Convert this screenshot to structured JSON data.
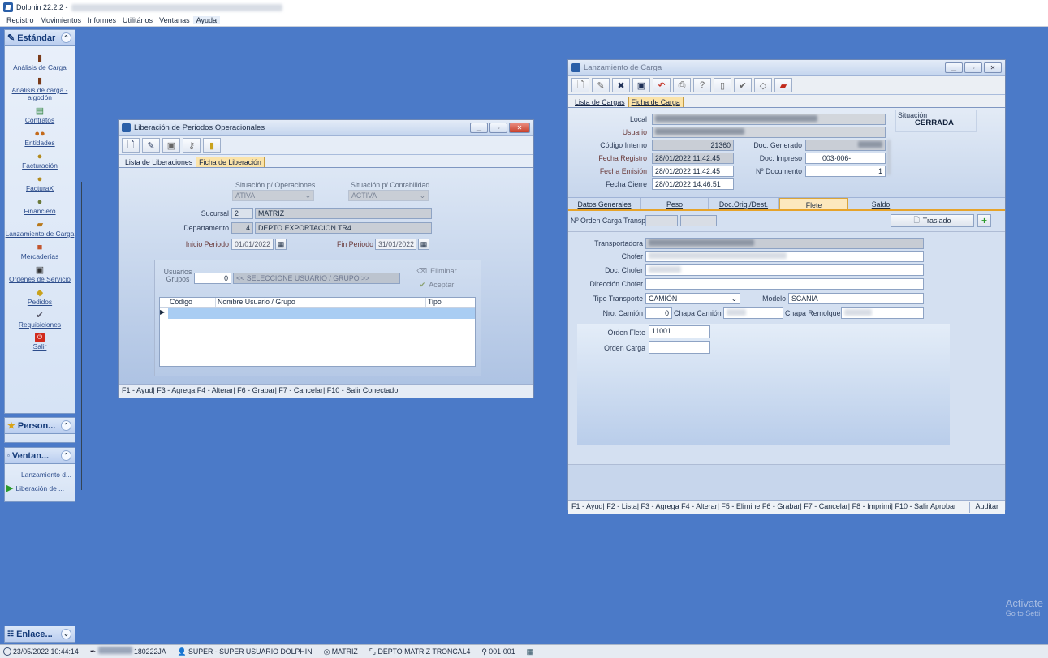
{
  "app": {
    "title": "Dolphin 22.2.2 -",
    "menu": [
      "Registro",
      "Movimientos",
      "Informes",
      "Utilitários",
      "Ventanas",
      "Ayuda"
    ]
  },
  "sidebar": {
    "estandar": {
      "title": "Estándar",
      "items": [
        {
          "label": "Análisis de Carga",
          "icon": "bag-icon"
        },
        {
          "label": "Análisis de carga - algodón",
          "icon": "bag-icon"
        },
        {
          "label": "Contratos",
          "icon": "contract-icon"
        },
        {
          "label": "Entidades",
          "icon": "people-icon"
        },
        {
          "label": "Facturación",
          "icon": "moneybag-icon"
        },
        {
          "label": "FacturaX",
          "icon": "moneybag-icon"
        },
        {
          "label": "Financiero",
          "icon": "moneybag-icon"
        },
        {
          "label": "Lanzamiento de Carga",
          "icon": "truck-icon"
        },
        {
          "label": "Mercaderías",
          "icon": "box-icon"
        },
        {
          "label": "Ordenes de Servicio",
          "icon": "clipboard-icon"
        },
        {
          "label": "Pedidos",
          "icon": "cart-icon"
        },
        {
          "label": "Requisiciones",
          "icon": "check-icon"
        },
        {
          "label": "Salir",
          "icon": "exit-icon"
        }
      ]
    },
    "personal": {
      "title": "Person..."
    },
    "ventanas": {
      "title": "Ventan...",
      "items": [
        "Lanzamiento d...",
        "Liberación de ..."
      ]
    },
    "enlaces": {
      "title": "Enlace..."
    }
  },
  "liberacion": {
    "title": "Liberación de Periodos Operacionales",
    "tabs": [
      "Lista de Liberaciones",
      "Ficha de Liberación"
    ],
    "sit_oper_label": "Situación p/ Operaciones",
    "sit_oper_value": "ATIVA",
    "sit_cont_label": "Situación p/ Contabilidad",
    "sit_cont_value": "ACTIVA",
    "sucursal_label": "Sucursal",
    "sucursal_code": "2",
    "sucursal_name": "MATRIZ",
    "depto_label": "Departamento",
    "depto_code": "4",
    "depto_name": "DEPTO EXPORTACION TR4",
    "inicio_label": "Inicio Periodo",
    "inicio_value": "01/01/2022",
    "fin_label": "Fin Periodo",
    "fin_value": "31/01/2022",
    "usuarios_label": "Usuarios Grupos",
    "usuarios_count": "0",
    "usuarios_placeholder": "<< SELECCIONE USUARIO / GRUPO >>",
    "eliminar": "Eliminar",
    "aceptar": "Aceptar",
    "grid_headers": [
      "Código",
      "Nombre Usuario / Grupo",
      "Tipo"
    ],
    "status": "F1 - Ayud| F3 - Agrega F4 - Alterar| F6 - Grabar| F7 - Cancelar| F10 - Salir Conectado"
  },
  "lanzamiento": {
    "title": "Lanzamiento de Carga",
    "tabs": [
      "Lista de Cargas",
      "Ficha de Carga"
    ],
    "local_label": "Local",
    "usuario_label": "Usuario",
    "codigo_label": "Código Interno",
    "codigo_value": "21360",
    "fecha_registro_label": "Fecha Registro",
    "fecha_registro_value": "28/01/2022 11:42:45",
    "fecha_emision_label": "Fecha Emisión",
    "fecha_emision_value": "28/01/2022 11:42:45",
    "fecha_cierre_label": "Fecha Cierre",
    "fecha_cierre_value": "28/01/2022 14:46:51",
    "doc_generado_label": "Doc. Generado",
    "doc_impreso_label": "Doc. Impreso",
    "doc_impreso_value": "003-006-",
    "n_documento_label": "Nº Documento",
    "n_documento_value": "1",
    "situacion_label": "Situación",
    "situacion_value": "CERRADA",
    "subtabs": [
      "Datos Generales",
      "Peso",
      "Doc.Orig./Dest.",
      "Flete",
      "Saldo"
    ],
    "orden_carga_transp_label": "Nº Orden Carga Transp.",
    "traslado": "Traslado",
    "transportadora_label": "Transportadora",
    "chofer_label": "Chofer",
    "doc_chofer_label": "Doc. Chofer",
    "direccion_chofer_label": "Dirección Chofer",
    "tipo_transporte_label": "Tipo Transporte",
    "tipo_transporte_value": "CAMIÓN",
    "modelo_label": "Modelo",
    "modelo_value": "SCANIA",
    "nro_camion_label": "Nro. Camión",
    "nro_camion_value": "0",
    "chapa_camion_label": "Chapa Camión",
    "chapa_remolque_label": "Chapa Remolque",
    "orden_flete_label": "Orden Flete",
    "orden_flete_value": "11001",
    "orden_carga_label": "Orden Carga",
    "status": "F1 - Ayud| F2 - Lista| F3 - Agrega F4 - Alterar| F5 - Elimine F6 - Grabar| F7 - Cancelar| F8 - Imprimi| F10 - Salir Aprobar",
    "auditar": "Auditar"
  },
  "statusbar": {
    "datetime": "23/05/2022 10:44:14",
    "code": "180222JA",
    "user": "SUPER - SUPER USUARIO DOLPHIN",
    "branch": "MATRIZ",
    "depto": "DEPTO MATRIZ TRONCAL4",
    "terminal": "001-001"
  },
  "watermark": {
    "line1": "Activate",
    "line2": "Go to Setti"
  }
}
